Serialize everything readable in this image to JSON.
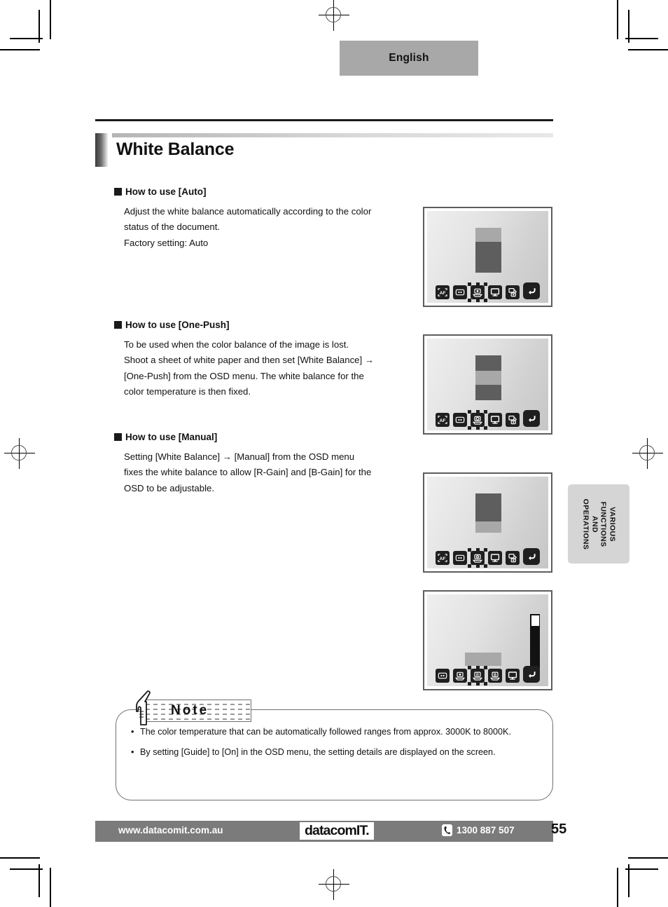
{
  "header": {
    "language_tab": "English"
  },
  "page_title": "White Balance",
  "sections": [
    {
      "heading": "How to use [Auto]",
      "body": "Adjust the white balance automatically according to the color status of the document.\nFactory setting: Auto"
    },
    {
      "heading": "How to use [One-Push]",
      "body": "To be used when the color balance of the image is lost. Shoot a sheet of white paper and then set [White Balance] → [One-Push] from the OSD menu. The white balance for the color temperature is then fixed."
    },
    {
      "heading": "How to use [Manual]",
      "body": "Setting [White Balance] → [Manual] from the OSD menu fixes the white balance to allow [R-Gain] and [B-Gain] for the OSD to be adjustable."
    }
  ],
  "osd_screens": [
    {
      "name": "auto-white-balance-osd",
      "guide_bands": [
        "#a8a8a8",
        "#5e5e5e"
      ],
      "icons": [
        "af-icon",
        "iris-icon",
        "white-balance-icon",
        "monitor-icon",
        "image-rotate-icon"
      ],
      "selected_index": 2,
      "back_icon": "back-arrow-icon",
      "slider": null
    },
    {
      "name": "one-push-white-balance-osd",
      "guide_bands": [
        "#5e5e5e",
        "#a8a8a8",
        "#5e5e5e"
      ],
      "icons": [
        "af-icon",
        "iris-icon",
        "white-balance-onepush-icon",
        "monitor-icon",
        "image-rotate-icon"
      ],
      "selected_index": 2,
      "back_icon": "back-arrow-icon",
      "slider": null
    },
    {
      "name": "manual-white-balance-osd",
      "guide_bands": [
        "#5e5e5e",
        "#a8a8a8"
      ],
      "icons": [
        "af-icon",
        "iris-icon",
        "white-balance-manual-icon",
        "monitor-icon",
        "image-rotate-icon"
      ],
      "selected_index": 2,
      "back_icon": "back-arrow-icon",
      "slider": null
    },
    {
      "name": "gain-adjust-osd",
      "guide_bands": [
        "#a8a8a8"
      ],
      "icons": [
        "iris-icon",
        "white-balance-icon",
        "r-gain-icon",
        "b-gain-icon",
        "monitor-icon"
      ],
      "selected_index": 2,
      "back_icon": "back-arrow-icon",
      "slider": {
        "name": "gain-level-slider",
        "value_position": "top"
      }
    }
  ],
  "side_tab": {
    "line1": "VARIOUS",
    "line2": "FUNCTIONS",
    "line3": "AND",
    "line4": "OPERATIONS"
  },
  "note": {
    "label": "Note",
    "bullet": "•",
    "items": [
      "The color temperature that can be automatically followed ranges from approx. 3000K to 8000K.",
      "By setting [Guide] to [On] in the OSD menu, the setting details are displayed on the screen."
    ]
  },
  "footer": {
    "url": "www.datacomit.com.au",
    "logo": "datacomIT.",
    "phone": "1300 887 507",
    "phone_icon": "telephone-icon",
    "page_number": "55"
  },
  "colors": {
    "footer_bar": "#7b7b7b",
    "language_tab": "#a8a8a8",
    "side_tab": "#d5d5d5",
    "guide_light": "#a8a8a8",
    "guide_dark": "#5e5e5e",
    "icon_bg": "#1f1f1f"
  }
}
